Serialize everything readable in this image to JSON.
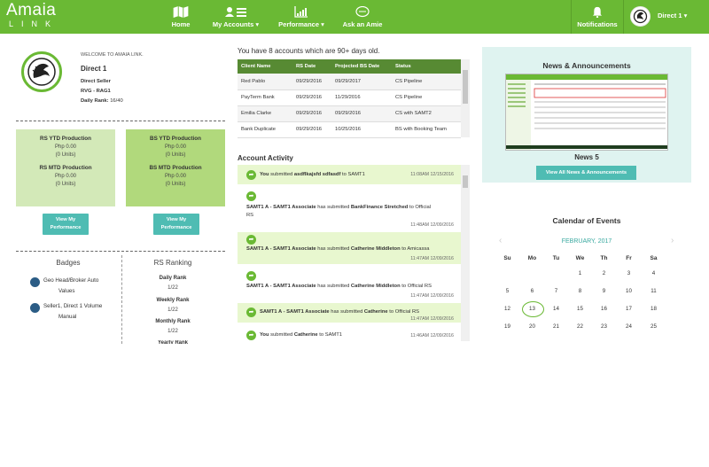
{
  "brand": {
    "name": "Amaia",
    "sub": "LINK"
  },
  "nav": {
    "home": "Home",
    "my_accounts": "My Accounts ▾",
    "performance": "Performance ▾",
    "ask": "Ask an Amie",
    "notifications": "Notifications",
    "user": "Direct 1 ▾"
  },
  "profile": {
    "welcome": "WELCOME TO AMAIA LINK.",
    "name": "Direct 1",
    "role": "Direct Seller",
    "group": "RVG - RAG1",
    "rank_label": "Daily Rank:",
    "rank_value": "16/40"
  },
  "production": [
    {
      "ytd_title": "RS YTD Production",
      "ytd_amount": "Php 0.00",
      "ytd_units": "(0 Units)",
      "mtd_title": "RS MTD Production",
      "mtd_amount": "Php 0.00",
      "mtd_units": "(0 Units)",
      "button": "View My Performance"
    },
    {
      "ytd_title": "BS YTD Production",
      "ytd_amount": "Php 0.00",
      "ytd_units": "(0 Units)",
      "mtd_title": "BS MTD Production",
      "mtd_amount": "Php 0.00",
      "mtd_units": "(0 Units)",
      "button": "View My Performance"
    }
  ],
  "badges": {
    "title": "Badges",
    "items": [
      {
        "line1": "Geo Head/Broker Auto",
        "line2": "Values"
      },
      {
        "line1": "Seller1, Direct 1 Volume",
        "line2": "Manual"
      }
    ]
  },
  "ranking": {
    "title": "RS Ranking",
    "items": [
      {
        "label": "Daily Rank",
        "value": "1/22"
      },
      {
        "label": "Weekly Rank",
        "value": "1/22"
      },
      {
        "label": "Monthly Rank",
        "value": "1/22"
      },
      {
        "label": "Yearly Rank",
        "value": ""
      }
    ]
  },
  "accounts": {
    "note": "You have 8 accounts which are 90+ days old.",
    "headers": [
      "Client Name",
      "RS Date",
      "Projected BS Date",
      "Status"
    ],
    "rows": [
      [
        "Red Pablo",
        "09/29/2016",
        "09/29/2017",
        "CS Pipeline"
      ],
      [
        "PayTerm Bank",
        "09/29/2016",
        "11/29/2016",
        "CS Pipeline"
      ],
      [
        "Emilia Clarke",
        "09/29/2016",
        "09/29/2016",
        "CS with SAMT2"
      ],
      [
        "Bank Duplicate",
        "09/29/2016",
        "10/25/2016",
        "BS with Booking Team"
      ]
    ]
  },
  "activity": {
    "title": "Account Activity",
    "items": [
      {
        "pre": "You",
        "mid": " submitted ",
        "bold2": "asdflkajsfd sdfasdf",
        "post": " to SAMT1",
        "cont": "",
        "time": "11:08AM 12/15/2016"
      },
      {
        "pre": "SAMT1 A - SAMT1 Associate",
        "mid": " has submitted ",
        "bold2": "BankFinance Stretched",
        "post": " to Official",
        "cont": "RS",
        "time": "11:48AM 12/09/2016"
      },
      {
        "pre": "SAMT1 A - SAMT1 Associate",
        "mid": " has submitted ",
        "bold2": "Catherine Middleton",
        "post": " to Amicassa",
        "cont": "",
        "time": "11:47AM 12/09/2016"
      },
      {
        "pre": "SAMT1 A - SAMT1 Associate",
        "mid": " has submitted ",
        "bold2": "Catherine Middleton",
        "post": " to Official RS",
        "cont": "",
        "time": "11:47AM 12/09/2016"
      },
      {
        "pre": "SAMT1 A - SAMT1 Associate",
        "mid": " has submitted ",
        "bold2": "Catherine",
        "post": "          to Official RS",
        "cont": "",
        "time": "11:47AM 12/09/2016"
      },
      {
        "pre": "You",
        "mid": " submitted ",
        "bold2": "Catherine",
        "post": "          to SAMT1",
        "cont": "",
        "time": "11:46AM 12/09/2016"
      }
    ]
  },
  "news": {
    "title": "News & Announcements",
    "caption": "News 5",
    "button": "View All News & Announcements"
  },
  "calendar": {
    "title": "Calendar of Events",
    "month": "FEBRUARY, 2017",
    "dow": [
      "Su",
      "Mo",
      "Tu",
      "We",
      "Th",
      "Fr",
      "Sa"
    ],
    "weeks": [
      [
        "",
        "",
        "",
        "1",
        "2",
        "3",
        "4"
      ],
      [
        "5",
        "6",
        "7",
        "8",
        "9",
        "10",
        "11"
      ],
      [
        "12",
        "13",
        "14",
        "15",
        "16",
        "17",
        "18"
      ],
      [
        "19",
        "20",
        "21",
        "22",
        "23",
        "24",
        "25"
      ]
    ],
    "today": "13",
    "accent": "#6ab934"
  },
  "colors": {
    "brand": "#6ab934",
    "teal": "#4fbcb3",
    "table_header": "#578a33"
  }
}
